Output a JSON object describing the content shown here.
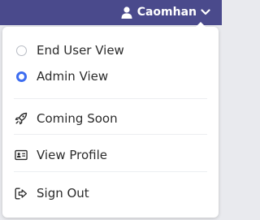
{
  "topbar": {
    "username": "Caomhan",
    "bg_color": "#4a4a8c",
    "user_icon": "user-icon",
    "dropdown_icon": "chevron-down-icon"
  },
  "menu": {
    "view_options": [
      {
        "label": "End User View",
        "selected": false
      },
      {
        "label": "Admin View",
        "selected": true
      }
    ],
    "actions": [
      {
        "label": "Coming Soon",
        "icon": "rocket-icon"
      },
      {
        "label": "View Profile",
        "icon": "id-card-icon"
      },
      {
        "label": "Sign Out",
        "icon": "sign-out-icon"
      }
    ],
    "accent_color": "#3d6df0"
  }
}
